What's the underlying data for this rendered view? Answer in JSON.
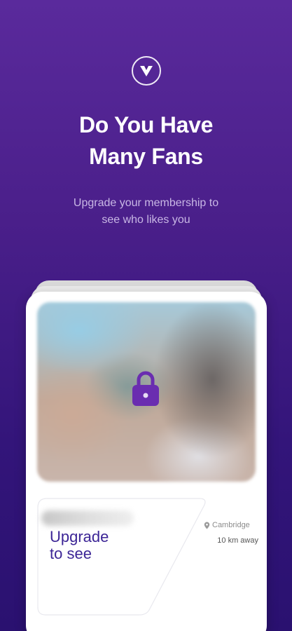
{
  "header": {
    "logo_icon": "brand-v-logo-icon",
    "title_line1": "Do You Have",
    "title_line2": "Many Fans",
    "subtitle_line1": "Upgrade your membership to",
    "subtitle_line2": "see who likes you"
  },
  "card": {
    "photo_state": "blurred",
    "lock_icon": "lock-icon",
    "upgrade_line1": "Upgrade",
    "upgrade_line2": "to see",
    "location_icon": "map-pin-icon",
    "location": "Cambridge",
    "distance": "10 km away"
  },
  "colors": {
    "background_top": "#5a2a9c",
    "background_bottom": "#2a1170",
    "accent_purple": "#6a2db0",
    "upgrade_text": "#3c2596"
  }
}
